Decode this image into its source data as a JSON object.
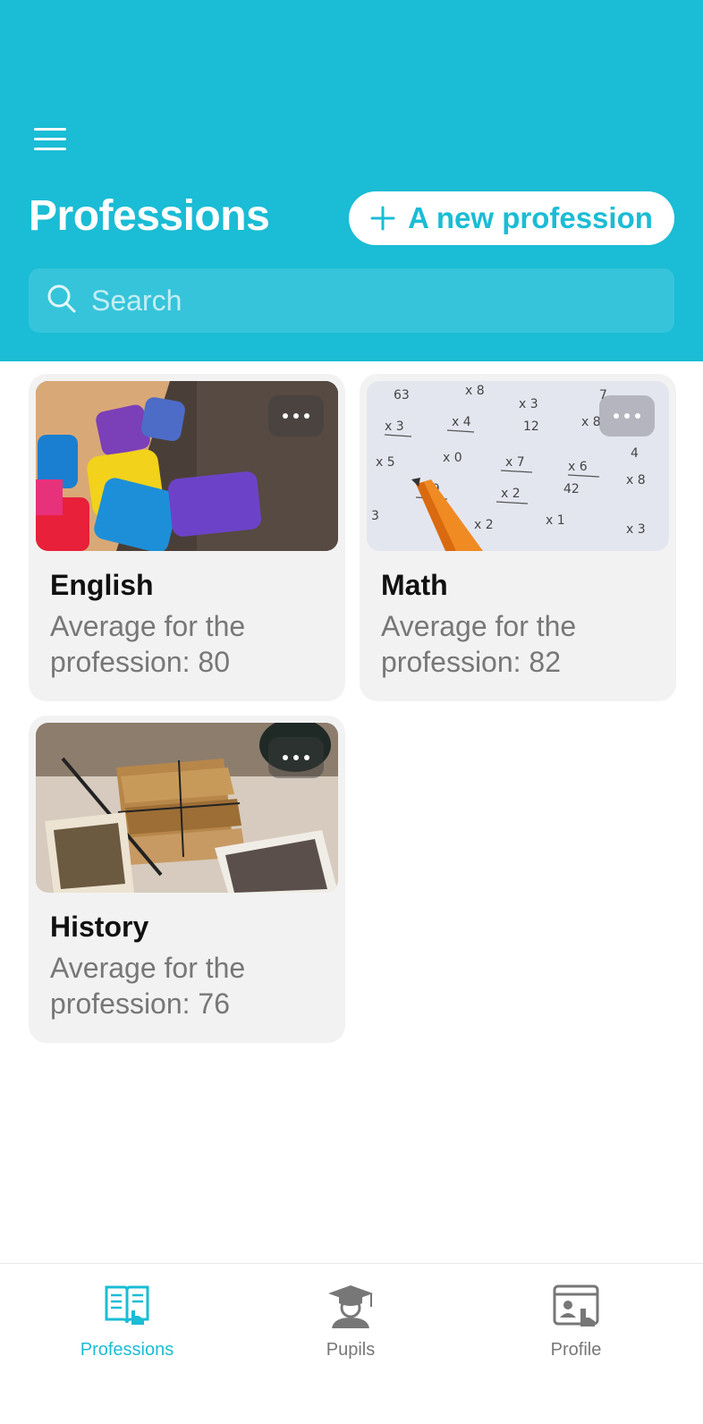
{
  "header": {
    "title": "Professions",
    "new_button_label": "A new profession",
    "search_placeholder": "Search",
    "background_color": "#1bbcd5"
  },
  "cards": [
    {
      "title": "English",
      "average_label": "Average for the profession: 80",
      "image": "alphabet-blocks-photo"
    },
    {
      "title": "Math",
      "average_label": "Average for the profession: 82",
      "image": "math-worksheet-photo"
    },
    {
      "title": "History",
      "average_label": "Average for the profession: 76",
      "image": "old-books-photos"
    }
  ],
  "nav": [
    {
      "label": "Professions",
      "icon": "book-icon",
      "active": true
    },
    {
      "label": "Pupils",
      "icon": "graduate-icon",
      "active": false
    },
    {
      "label": "Profile",
      "icon": "profile-screen-icon",
      "active": false
    }
  ],
  "colors": {
    "accent": "#1bbcd5",
    "muted_text": "#777777",
    "card_bg": "#f2f2f2"
  }
}
